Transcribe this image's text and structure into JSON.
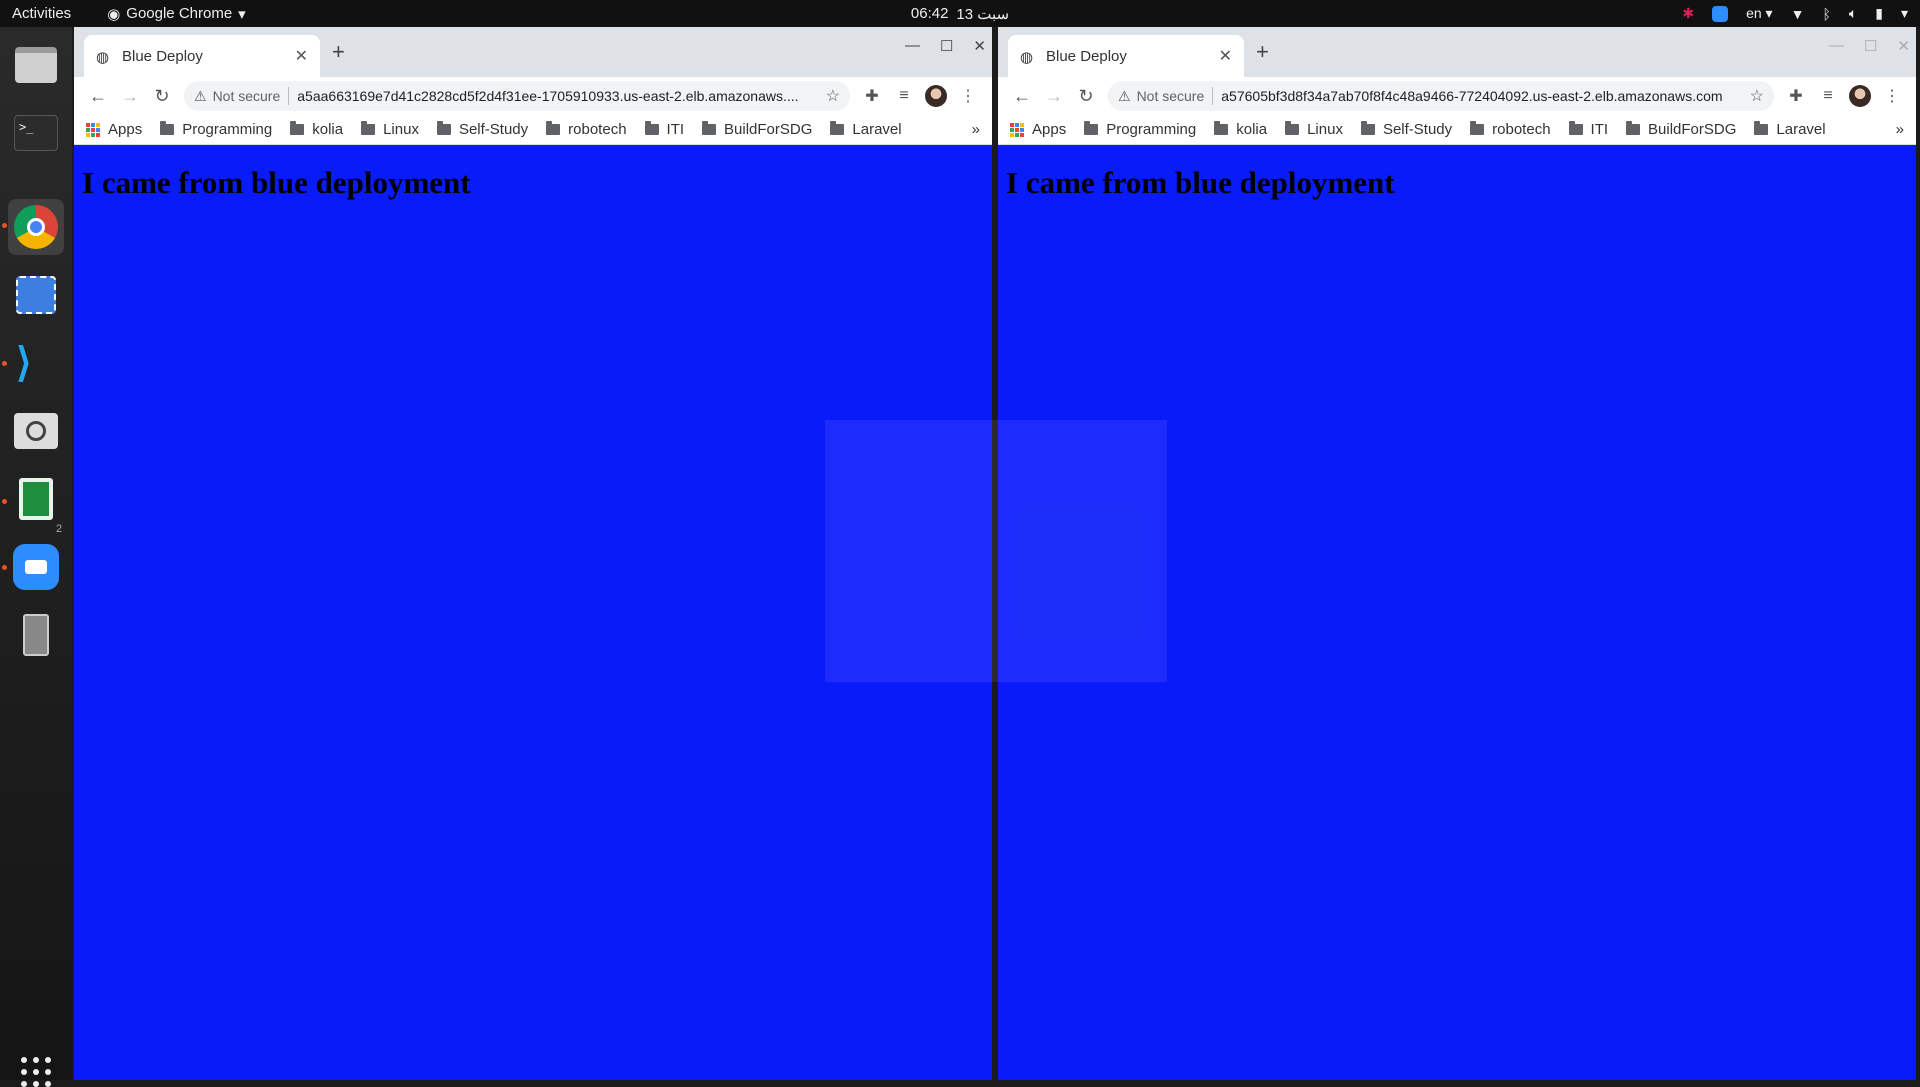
{
  "topbar": {
    "activities": "Activities",
    "app_name": "Google Chrome",
    "time": "06:42",
    "date": "سبت 13",
    "language": "en"
  },
  "dock": {
    "items": [
      {
        "name": "files",
        "icon": "files-icon"
      },
      {
        "name": "terminal",
        "icon": "terminal-icon"
      },
      {
        "name": "chrome",
        "icon": "chrome-icon"
      },
      {
        "name": "screenshot",
        "icon": "screenshot-icon"
      },
      {
        "name": "vscode",
        "icon": "vscode-icon"
      },
      {
        "name": "magnifier",
        "icon": "magnifier-icon"
      },
      {
        "name": "spreadsheet",
        "icon": "spreadsheet-icon"
      },
      {
        "name": "zoom",
        "icon": "zoom-icon"
      },
      {
        "name": "device",
        "icon": "device-icon"
      }
    ],
    "badge": "2"
  },
  "windows": [
    {
      "tab_title": "Blue Deploy",
      "not_secure": "Not secure",
      "url": "a5aa663169e7d41c2828cd5f2d4f31ee-1705910933.us-east-2.elb.amazonaws....",
      "heading": "I came from blue deployment"
    },
    {
      "tab_title": "Blue Deploy",
      "not_secure": "Not secure",
      "url": "a57605bf3d8f34a7ab70f8f4c48a9466-772404092.us-east-2.elb.amazonaws.com",
      "heading": "I came from blue deployment"
    }
  ],
  "bookmarks": {
    "apps": "Apps",
    "folders": [
      "Programming",
      "kolia",
      "Linux",
      "Self-Study",
      "robotech",
      "ITI",
      "BuildForSDG",
      "Laravel"
    ],
    "more": "»"
  },
  "colors": {
    "page_background": "#0a1bfa",
    "topbar": "#111111",
    "accent": "#e95420"
  }
}
